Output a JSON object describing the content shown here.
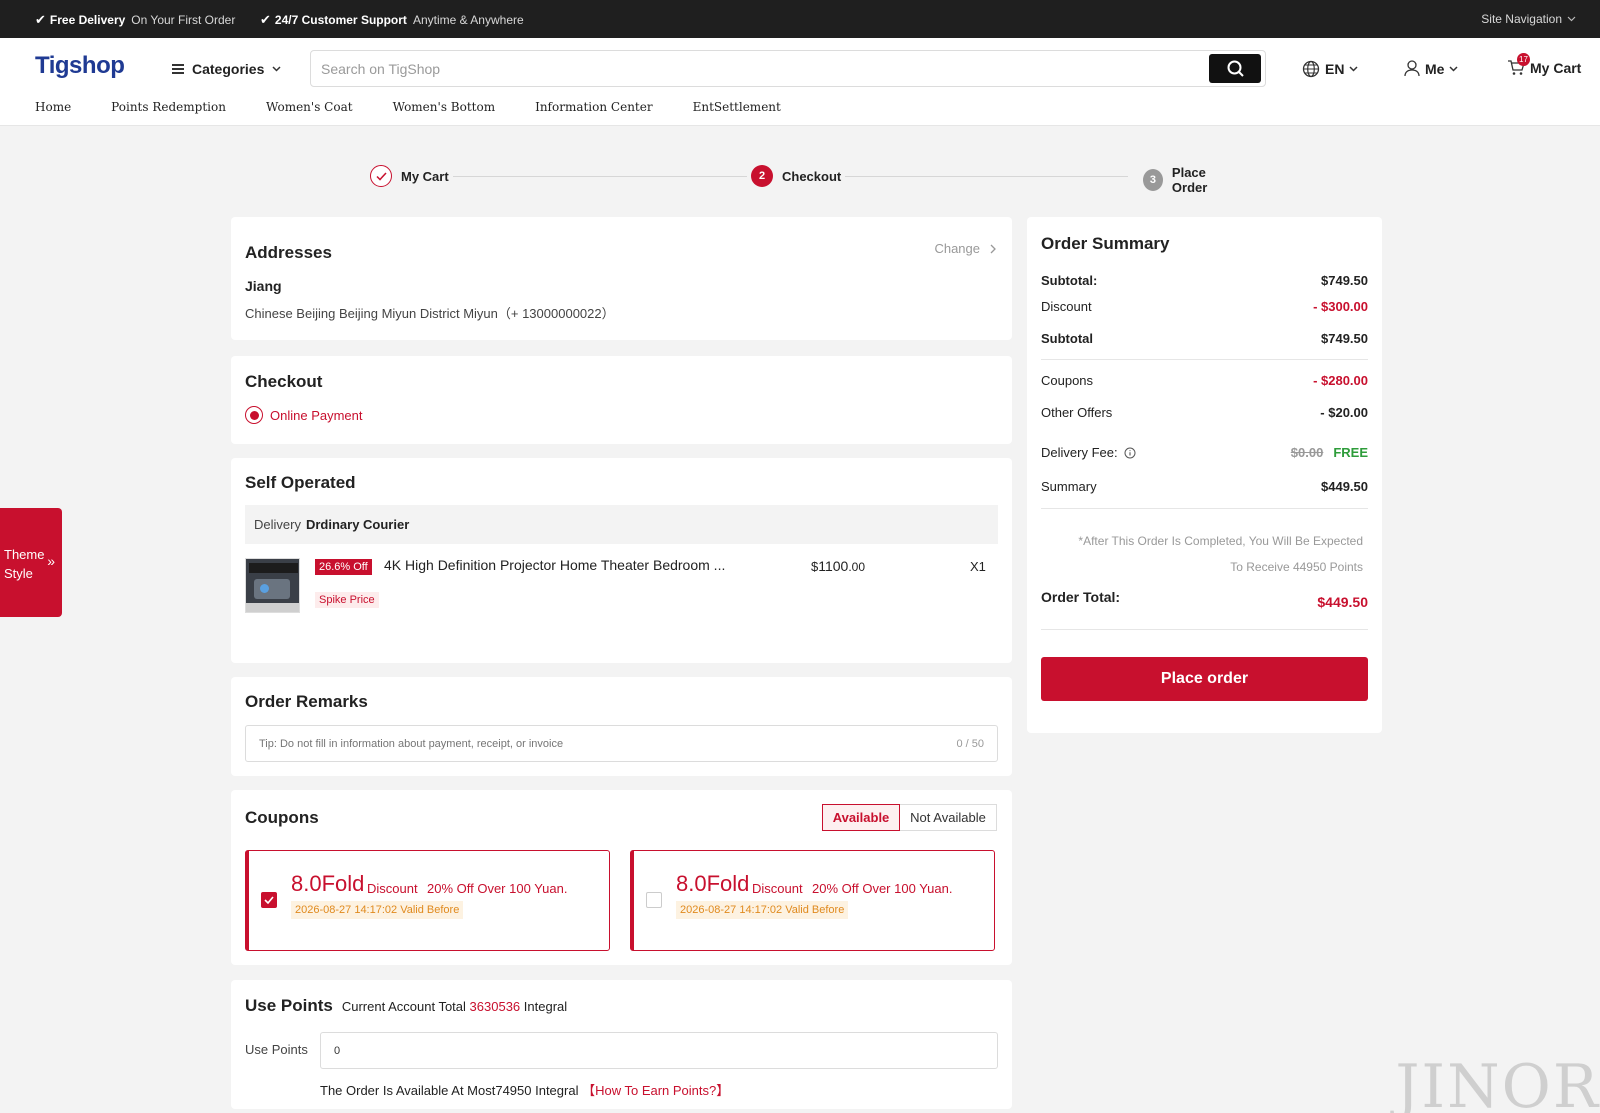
{
  "topbar": {
    "promo1_title": "Free Delivery",
    "promo1_sub": "On Your First Order",
    "promo2_title": "24/7 Customer Support",
    "promo2_sub": "Anytime & Anywhere",
    "site_nav": "Site Navigation"
  },
  "header": {
    "logo": "Tigshop",
    "categories": "Categories",
    "search_placeholder": "Search on TigShop",
    "language": "EN",
    "account": "Me",
    "cart_label": "My Cart",
    "cart_count": "17"
  },
  "nav": [
    "Home",
    "Points Redemption",
    "Women's Coat",
    "Women's Bottom",
    "Information Center",
    "EntSettlement"
  ],
  "steps": {
    "step1": "My Cart",
    "step2_num": "2",
    "step2": "Checkout",
    "step3_num": "3",
    "step3": "Place Order"
  },
  "address": {
    "title": "Addresses",
    "change": "Change",
    "name": "Jiang",
    "detail": "Chinese Beijing Beijing Miyun District Miyun（+ 13000000022）"
  },
  "checkout": {
    "title": "Checkout",
    "payment": "Online Payment"
  },
  "shop": {
    "title": "Self Operated",
    "delivery_label": "Delivery",
    "delivery_method": "Drdinary Courier",
    "product": {
      "discount_badge": "26.6% Off",
      "name": "4K High Definition Projector Home Theater Bedroom ...",
      "price_symbol": "$",
      "price_main": "1100",
      "price_decimal": ".00",
      "quantity": "X1",
      "tag": "Spike Price"
    }
  },
  "remarks": {
    "title": "Order Remarks",
    "placeholder": "Tip: Do not fill in information about payment, receipt, or invoice",
    "counter": "0 / 50"
  },
  "coupons": {
    "title": "Coupons",
    "tab_available": "Available",
    "tab_not_available": "Not Available",
    "items": [
      {
        "amount": "8.0Fold",
        "type": "Discount",
        "rule": "20% Off Over 100 Yuan.",
        "valid": "2026-08-27 14:17:02 Valid Before",
        "checked": true
      },
      {
        "amount": "8.0Fold",
        "type": "Discount",
        "rule": "20% Off Over 100 Yuan.",
        "valid": "2026-08-27 14:17:02 Valid Before",
        "checked": false
      }
    ]
  },
  "points": {
    "title": "Use Points",
    "account_prefix": "Current Account Total",
    "account_total": "3630536",
    "account_suffix": "Integral",
    "label": "Use Points",
    "value": "0",
    "note": "The Order Is Available At Most74950 Integral",
    "earn_link": "【How To Earn Points?】"
  },
  "summary": {
    "title": "Order Summary",
    "subtotal_label": "Subtotal:",
    "subtotal": "$749.50",
    "discount_label": "Discount",
    "discount": "- $300.00",
    "subtotal2_label": "Subtotal",
    "subtotal2": "$749.50",
    "coupons_label": "Coupons",
    "coupons": "- $280.00",
    "other_label": "Other Offers",
    "other": "- $20.00",
    "delivery_label": "Delivery Fee:",
    "delivery_original": "$0.00",
    "delivery_free": "FREE",
    "summary_label": "Summary",
    "summary": "$449.50",
    "note_line1": "*After This Order Is Completed, You Will Be Expected",
    "note_line2": "To Receive 44950 Points",
    "total_label": "Order Total:",
    "total": "$449.50",
    "place_order": "Place order"
  },
  "theme_tab": {
    "line1": "Theme",
    "line2": "Style"
  },
  "watermark": "JINOR",
  "colors": {
    "accent": "#c8102e",
    "topbar": "#1f1f1f",
    "free": "#2e9c3a",
    "coupon_date_bg": "#fdf2e1"
  }
}
